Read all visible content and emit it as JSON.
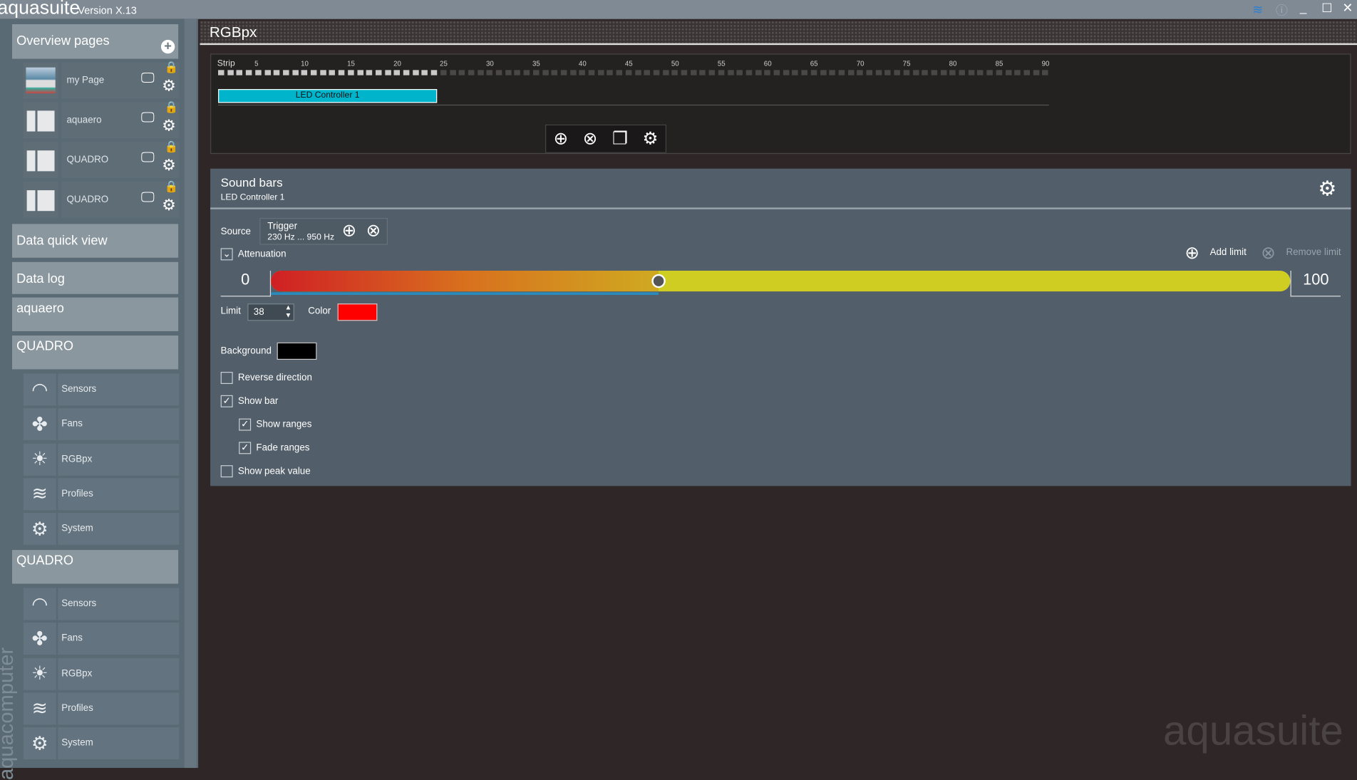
{
  "app": {
    "name": "aquasuite",
    "version": "Version X.13",
    "watermark": "aquasuite",
    "vendor": "aquacomputer"
  },
  "sidebar": {
    "overview_title": "Overview pages",
    "pages": [
      {
        "label": "my Page"
      },
      {
        "label": "aquaero"
      },
      {
        "label": "QUADRO"
      },
      {
        "label": "QUADRO"
      }
    ],
    "data_quick_view": "Data quick view",
    "data_log": "Data log",
    "aquaero": "aquaero",
    "devices": [
      {
        "name": "QUADRO",
        "items": [
          "Sensors",
          "Fans",
          "RGBpx",
          "Profiles",
          "System"
        ]
      },
      {
        "name": "QUADRO",
        "items": [
          "Sensors",
          "Fans",
          "RGBpx",
          "Profiles",
          "System"
        ]
      }
    ]
  },
  "main": {
    "title": "RGBpx",
    "strip": {
      "label": "Strip",
      "ticks": [
        "5",
        "10",
        "15",
        "20",
        "25",
        "30",
        "35",
        "40",
        "45",
        "50",
        "55",
        "60",
        "65",
        "70",
        "75",
        "80",
        "85",
        "90"
      ],
      "total_leds": 90,
      "active_leds": 24,
      "controller": "LED Controller 1",
      "accent": "#00b4cc"
    },
    "sound_bars": {
      "title": "Sound bars",
      "subtitle": "LED Controller 1",
      "source_label": "Source",
      "source_name": "Trigger",
      "source_range": "230 Hz ... 950 Hz",
      "attenuation": "Attenuation",
      "add_limit": "Add limit",
      "remove_limit": "Remove limit",
      "min": "0",
      "max": "100",
      "limit_pct": 38,
      "limit_label": "Limit",
      "limit_value": "38",
      "color_label": "Color",
      "color": "#ff0000",
      "background_label": "Background",
      "background": "#000000",
      "options": [
        {
          "label": "Reverse direction",
          "checked": false
        },
        {
          "label": "Show bar",
          "checked": true
        },
        {
          "label": "Show ranges",
          "checked": true
        },
        {
          "label": "Fade ranges",
          "checked": true
        },
        {
          "label": "Show peak value",
          "checked": false
        }
      ]
    }
  }
}
